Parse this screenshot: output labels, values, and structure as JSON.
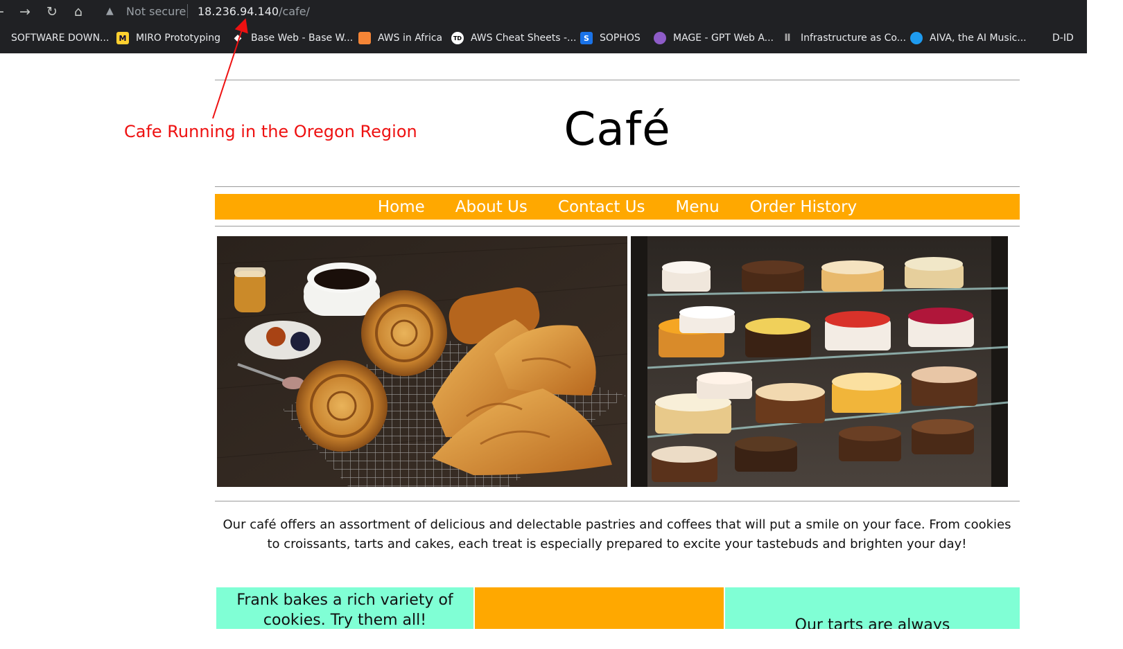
{
  "browser": {
    "security_icon": "warning-triangle-icon",
    "security_label": "Not secure",
    "url_host": "18.236.94.140",
    "url_path": "/cafe/",
    "bookmarks": [
      {
        "label": "SOFTWARE DOWN...",
        "icon": "folder-icon"
      },
      {
        "label": "MIRO Prototyping",
        "icon": "miro-icon"
      },
      {
        "label": "Base Web - Base W...",
        "icon": "baseweb-icon"
      },
      {
        "label": "AWS in Africa",
        "icon": "aws-cube-icon"
      },
      {
        "label": "AWS Cheat Sheets -...",
        "icon": "td-icon"
      },
      {
        "label": "SOPHOS",
        "icon": "sophos-icon"
      },
      {
        "label": "MAGE - GPT Web A...",
        "icon": "mage-icon"
      },
      {
        "label": "Infrastructure as Co...",
        "icon": "hashicorp-icon"
      },
      {
        "label": "AIVA, the AI Music...",
        "icon": "aiva-icon"
      },
      {
        "label": "D-ID",
        "icon": "d-id-icon"
      }
    ]
  },
  "annotation": {
    "text": "Cafe Running in the Oregon Region",
    "color": "#ee1111"
  },
  "site": {
    "title": "Café",
    "nav": [
      "Home",
      "About Us",
      "Contact Us",
      "Menu",
      "Order History"
    ],
    "accent_color": "#ffa800",
    "card_color": "#80ffd5",
    "hero_images": [
      "pastries-and-coffee-photo",
      "cake-display-case-photo"
    ],
    "intro": "Our café offers an assortment of delicious and delectable pastries and coffees that will put a smile on your face. From cookies to croissants, tarts and cakes, each treat is especially prepared to excite your tastebuds and brighten your day!",
    "cards": [
      {
        "text": "Frank bakes a rich variety of cookies. Try them all!"
      },
      {
        "text": ""
      },
      {
        "text": "Our tarts are always"
      }
    ]
  }
}
